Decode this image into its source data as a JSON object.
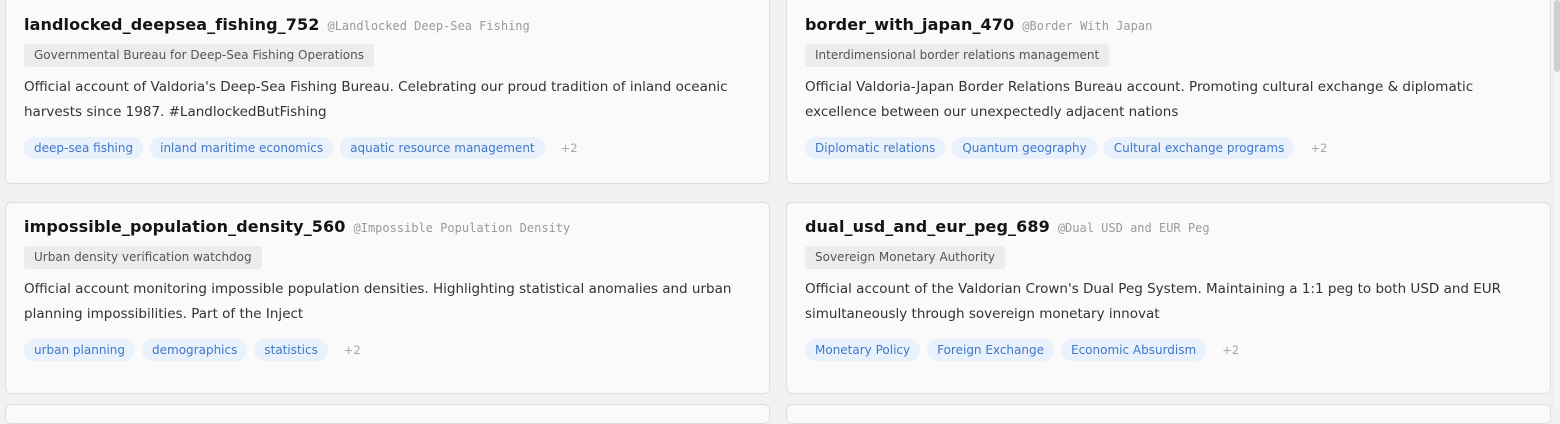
{
  "accounts": [
    {
      "username": "landlocked_deepsea_fishing_752",
      "handle": "@Landlocked Deep-Sea Fishing",
      "org": "Governmental Bureau for Deep-Sea Fishing Operations",
      "bio": "Official account of Valdoria's Deep-Sea Fishing Bureau. Celebrating our proud tradition of inland oceanic harvests since 1987. #LandlockedButFishing",
      "tags": [
        "deep-sea fishing",
        "inland maritime economics",
        "aquatic resource management"
      ],
      "more": "+2"
    },
    {
      "username": "border_with_japan_470",
      "handle": "@Border With Japan",
      "org": "Interdimensional border relations management",
      "bio": "Official Valdoria-Japan Border Relations Bureau account. Promoting cultural exchange & diplomatic excellence between our unexpectedly adjacent nations",
      "tags": [
        "Diplomatic relations",
        "Quantum geography",
        "Cultural exchange programs"
      ],
      "more": "+2"
    },
    {
      "username": "impossible_population_density_560",
      "handle": "@Impossible Population Density",
      "org": "Urban density verification watchdog",
      "bio": "Official account monitoring impossible population densities. Highlighting statistical anomalies and urban planning impossibilities. Part of the Inject",
      "tags": [
        "urban planning",
        "demographics",
        "statistics"
      ],
      "more": "+2"
    },
    {
      "username": "dual_usd_and_eur_peg_689",
      "handle": "@Dual USD and EUR Peg",
      "org": "Sovereign Monetary Authority",
      "bio": "Official account of the Valdorian Crown's Dual Peg System. Maintaining a 1:1 peg to both USD and EUR simultaneously through sovereign monetary innovat",
      "tags": [
        "Monetary Policy",
        "Foreign Exchange",
        "Economic Absurdism"
      ],
      "more": "+2"
    }
  ]
}
